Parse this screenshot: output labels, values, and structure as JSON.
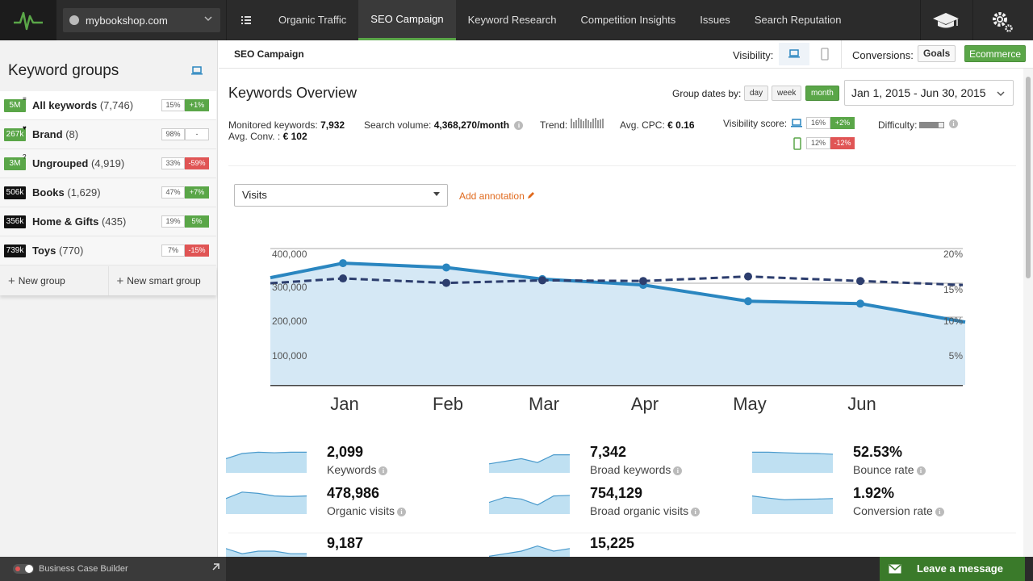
{
  "topbar": {
    "site": "mybookshop.com",
    "tabs": [
      {
        "label": "Organic Traffic"
      },
      {
        "label": "SEO Campaign"
      },
      {
        "label": "Keyword Research"
      },
      {
        "label": "Competition Insights"
      },
      {
        "label": "Issues"
      },
      {
        "label": "Search Reputation"
      }
    ],
    "active_tab": "SEO Campaign",
    "accent_color": "#5aa648"
  },
  "sidebar": {
    "title": "Keyword groups",
    "groups": [
      {
        "badge": "5M",
        "badge_color": "green",
        "mark": "≡",
        "name": "All keywords",
        "count": "(7,746)",
        "pct": "15%",
        "change": "+1%",
        "change_type": "pos"
      },
      {
        "badge": "267k",
        "badge_color": "green",
        "mark": "♥",
        "name": "Brand",
        "count": "(8)",
        "pct": "98%",
        "change": "-",
        "change_type": "neutral"
      },
      {
        "badge": "3M",
        "badge_color": "green",
        "mark": "?",
        "name": "Ungrouped",
        "count": "(4,919)",
        "pct": "33%",
        "change": "-59%",
        "change_type": "neg"
      },
      {
        "badge": "506k",
        "badge_color": "black",
        "mark": "",
        "name": "Books",
        "count": "(1,629)",
        "pct": "47%",
        "change": "+7%",
        "change_type": "pos"
      },
      {
        "badge": "356k",
        "badge_color": "black",
        "mark": "",
        "name": "Home & Gifts",
        "count": "(435)",
        "pct": "19%",
        "change": "5%",
        "change_type": "pos"
      },
      {
        "badge": "739k",
        "badge_color": "black",
        "mark": "",
        "name": "Toys",
        "count": "(770)",
        "pct": "7%",
        "change": "-15%",
        "change_type": "neg"
      }
    ],
    "new_group": "New group",
    "new_smart_group": "New smart group"
  },
  "subheader": {
    "title": "SEO Campaign",
    "visibility_label": "Visibility:",
    "conversions_label": "Conversions:",
    "goals": "Goals",
    "ecommerce": "Ecommerce"
  },
  "overview": {
    "title": "Keywords Overview",
    "group_dates_label": "Group dates by:",
    "group_buttons": [
      "day",
      "week",
      "month"
    ],
    "active_group": "month",
    "date_range": "Jan 1, 2015 - Jun 30, 2015",
    "monitored_label": "Monitored keywords:",
    "monitored_value": "7,932",
    "avg_conv_label": "Avg. Conv. :",
    "avg_conv_value": "€ 102",
    "search_volume_label": "Search volume:",
    "search_volume_value": "4,368,270/month",
    "trend_label": "Trend:",
    "trend_bars": [
      0.9,
      0.6,
      0.75,
      1.0,
      0.85,
      0.7,
      0.95,
      0.8,
      0.65,
      0.9,
      1.0,
      0.75,
      0.85,
      0.95
    ],
    "avg_cpc_label": "Avg. CPC:",
    "avg_cpc_value": "€ 0.16",
    "visibility_score_label": "Visibility score:",
    "vis_desktop_pct": "16%",
    "vis_desktop_chg": "+2%",
    "vis_mobile_pct": "12%",
    "vis_mobile_chg": "-12%",
    "difficulty_label": "Difficulty:",
    "difficulty_level": 0.8
  },
  "controls": {
    "metric": "Visits",
    "add_annotation": "Add annotation"
  },
  "chart_data": {
    "type": "line",
    "categories": [
      "Jan",
      "Feb",
      "Mar",
      "Apr",
      "May",
      "Jun"
    ],
    "series": [
      {
        "values": [
          397000,
          383000,
          345000,
          326000,
          273000,
          265000
        ],
        "axis": "left",
        "style": "solid-area",
        "color": "#2a86c0"
      },
      {
        "values": [
          16.6,
          15.9,
          16.3,
          16.2,
          16.9,
          16.2
        ],
        "axis": "right",
        "style": "dashed",
        "color": "#2d3e6e"
      }
    ],
    "y_left_ticks": [
      "100,000",
      "200,000",
      "300,000",
      "400,000"
    ],
    "y_right_ticks": [
      "5%",
      "10%",
      "15%",
      "20%"
    ],
    "y_left_range": [
      0,
      400000
    ],
    "y_right_range": [
      0,
      20
    ],
    "grid": true
  },
  "kpis": [
    {
      "value": "2,099",
      "label": "Keywords",
      "spark": [
        0.55,
        0.75,
        0.8,
        0.78,
        0.8,
        0.8
      ]
    },
    {
      "value": "7,342",
      "label": "Broad keywords",
      "spark": [
        0.35,
        0.45,
        0.55,
        0.4,
        0.7,
        0.7
      ]
    },
    {
      "value": "52.53%",
      "label": "Bounce rate",
      "spark": [
        0.8,
        0.8,
        0.78,
        0.76,
        0.75,
        0.72
      ]
    },
    {
      "value": "478,986",
      "label": "Organic visits",
      "spark": [
        0.6,
        0.85,
        0.8,
        0.7,
        0.68,
        0.7
      ]
    },
    {
      "value": "754,129",
      "label": "Broad organic visits",
      "spark": [
        0.45,
        0.65,
        0.58,
        0.35,
        0.7,
        0.72
      ]
    },
    {
      "value": "1.92%",
      "label": "Conversion rate",
      "spark": [
        0.7,
        0.62,
        0.55,
        0.57,
        0.58,
        0.6
      ]
    },
    {
      "value": "9,187",
      "label": "",
      "spark": [
        0.6,
        0.4,
        0.5,
        0.5,
        0.4,
        0.4
      ]
    },
    {
      "value": "15,225",
      "label": "",
      "spark": [
        0.3,
        0.4,
        0.5,
        0.7,
        0.5,
        0.6
      ]
    }
  ],
  "bottom": {
    "business_case": "Business Case Builder",
    "leave_message": "Leave a message"
  }
}
